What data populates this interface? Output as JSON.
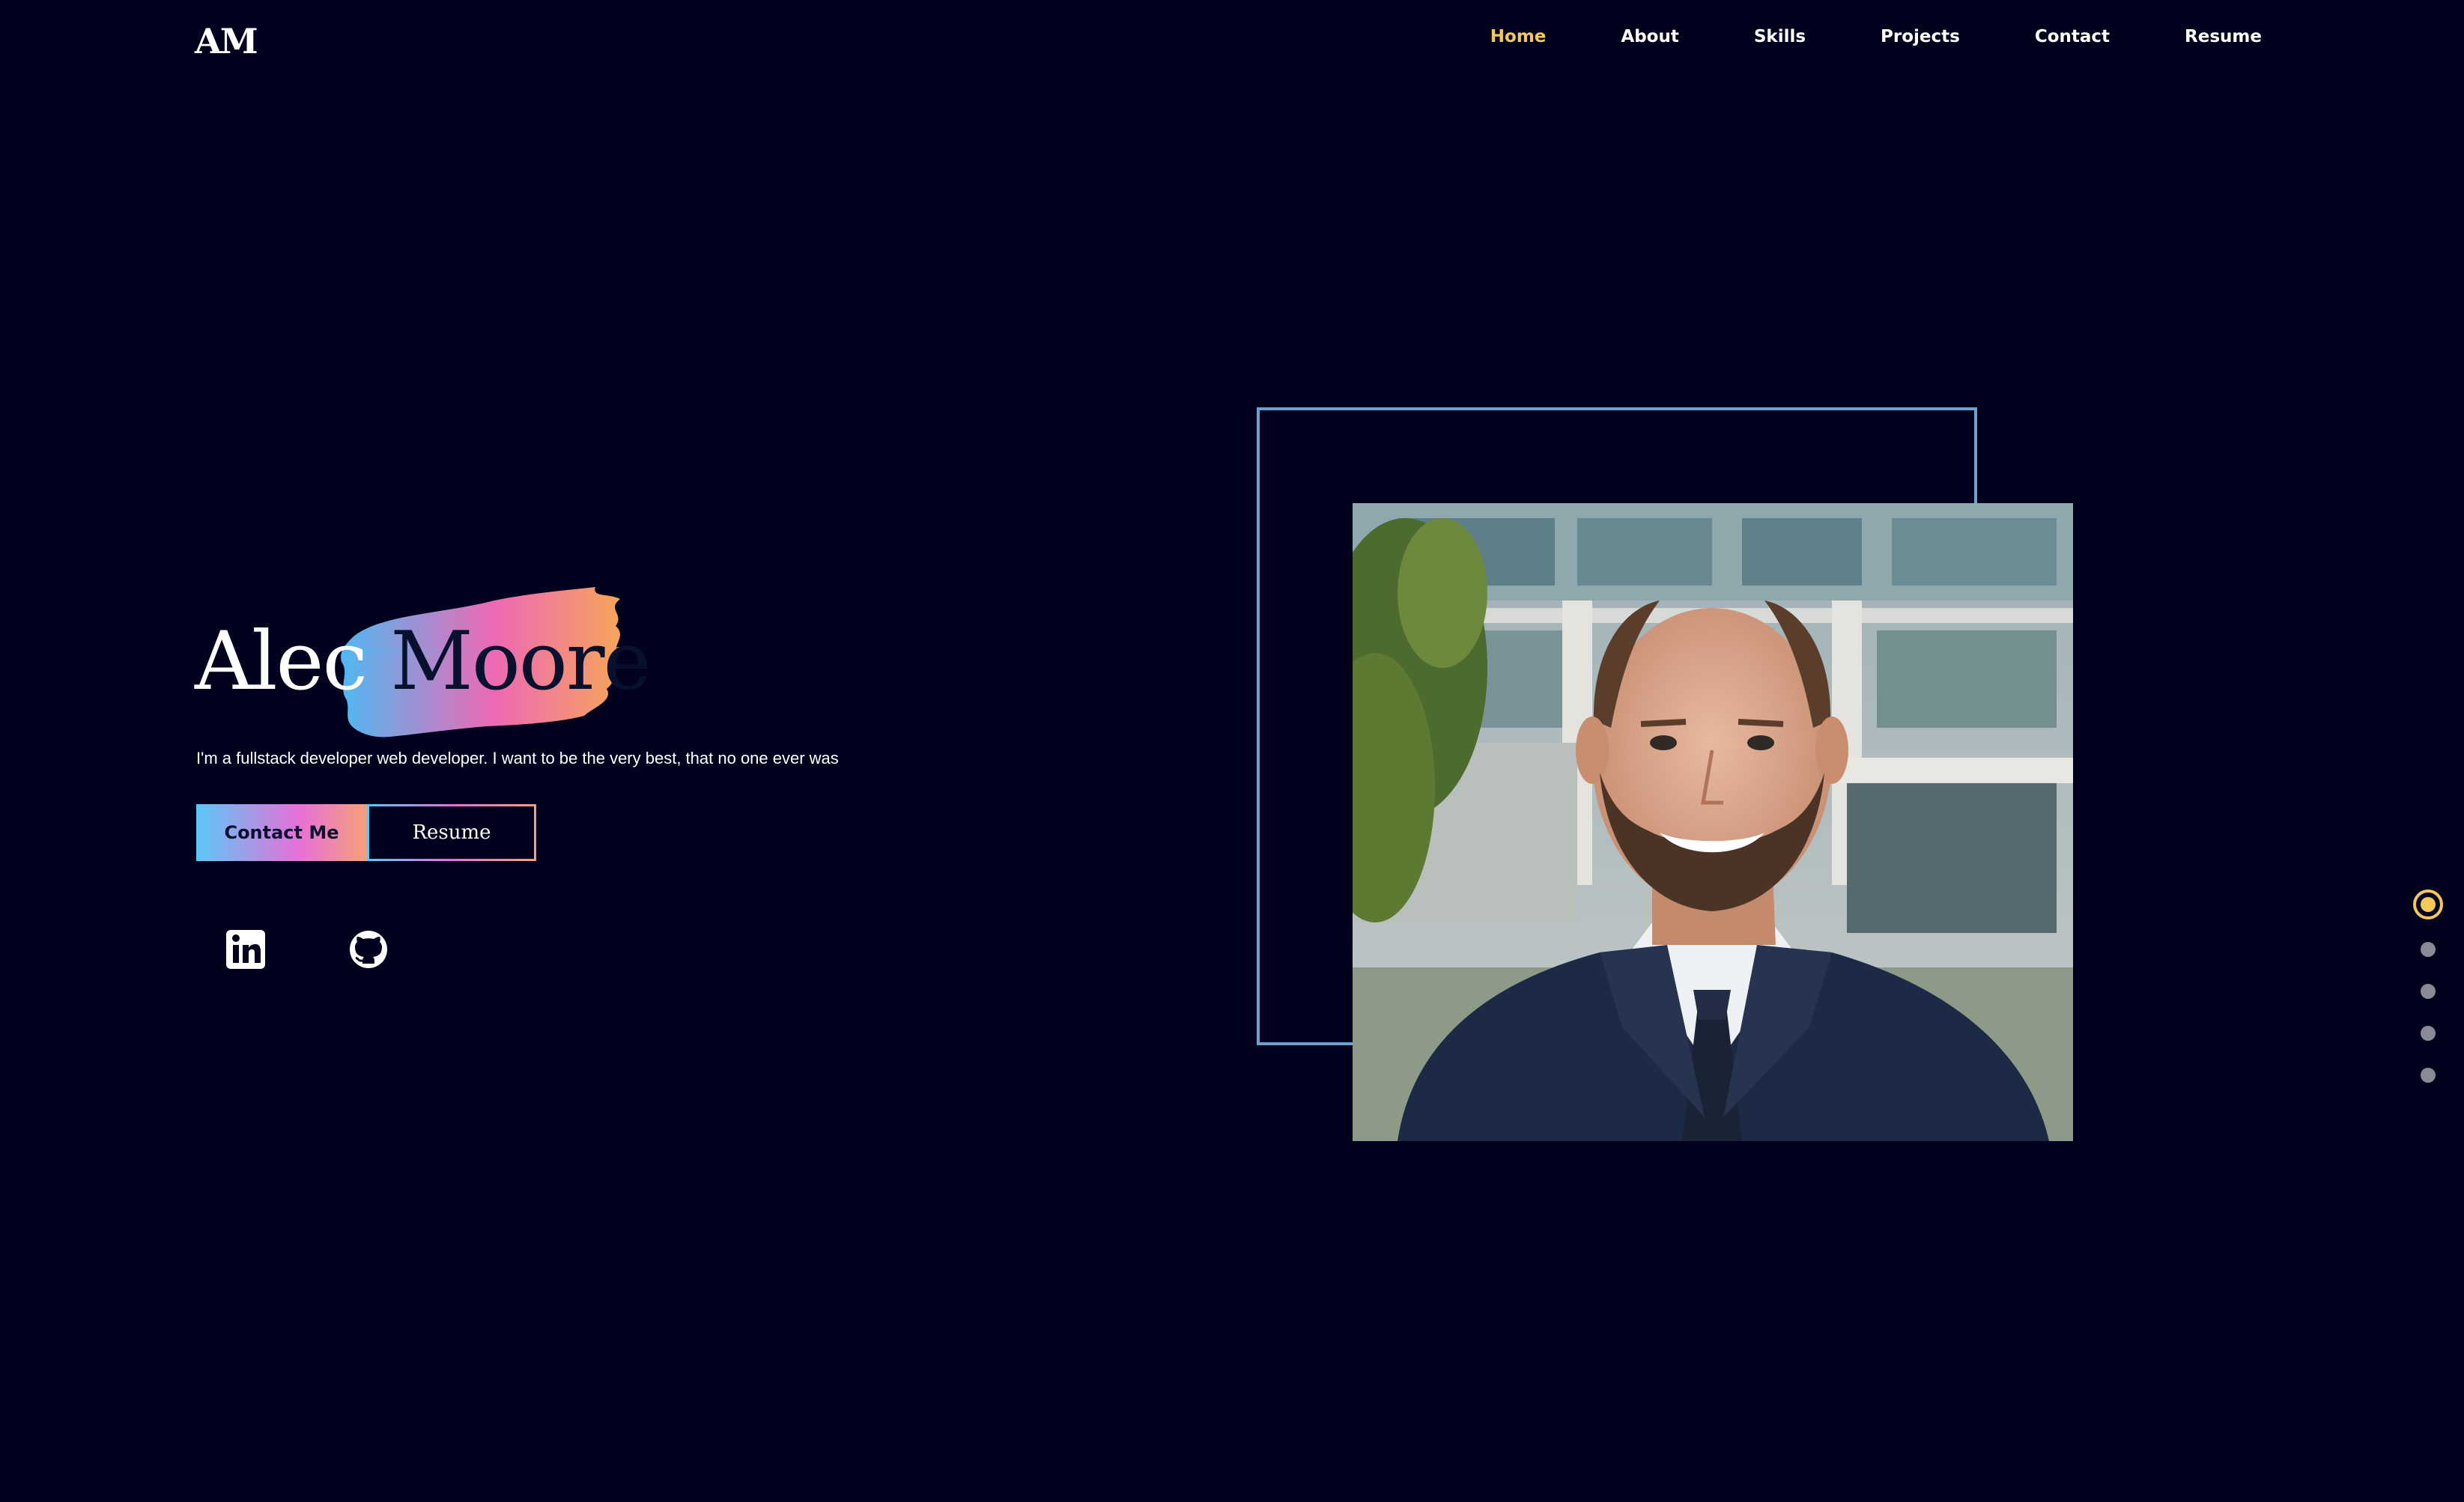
{
  "header": {
    "logo": "AM",
    "nav": [
      {
        "label": "Home",
        "active": true
      },
      {
        "label": "About",
        "active": false
      },
      {
        "label": "Skills",
        "active": false
      },
      {
        "label": "Projects",
        "active": false
      },
      {
        "label": "Contact",
        "active": false
      },
      {
        "label": "Resume",
        "active": false
      }
    ]
  },
  "hero": {
    "first_name": "Alec",
    "last_name": "Moore",
    "tagline": "I'm a fullstack developer web developer. I want to be the very best, that no one ever was",
    "contact_button": "Contact Me",
    "resume_button": "Resume",
    "social": [
      {
        "icon": "linkedin-icon"
      },
      {
        "icon": "github-icon"
      }
    ]
  },
  "section_dots": {
    "count": 5,
    "active_index": 0
  },
  "colors": {
    "background": "#02021f",
    "accent": "#f4c85a",
    "frame": "#6f9fcd",
    "gradient": [
      "#5bc8f7",
      "#e770d8",
      "#f5a07a"
    ]
  }
}
